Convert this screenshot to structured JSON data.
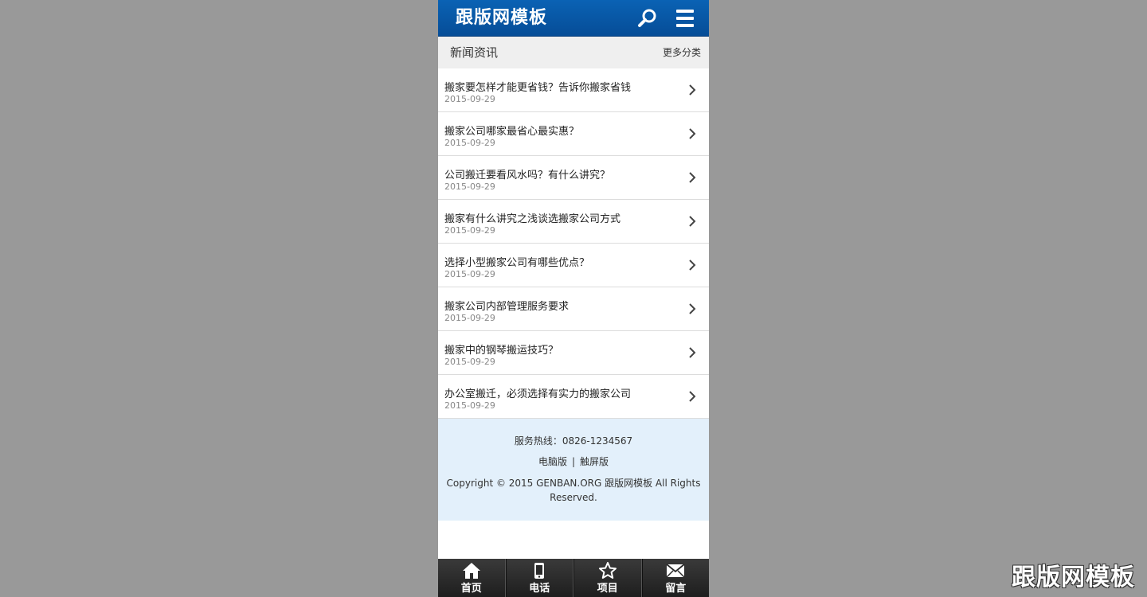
{
  "header": {
    "logo_text": "跟版网模板"
  },
  "section": {
    "title": "新闻资讯",
    "more_label": "更多分类"
  },
  "news": [
    {
      "title": "搬家要怎样才能更省钱？告诉你搬家省钱",
      "date": "2015-09-29"
    },
    {
      "title": "搬家公司哪家最省心最实惠？",
      "date": "2015-09-29"
    },
    {
      "title": "公司搬迁要看风水吗？有什么讲究？",
      "date": "2015-09-29"
    },
    {
      "title": "搬家有什么讲究之浅谈选搬家公司方式",
      "date": "2015-09-29"
    },
    {
      "title": "选择小型搬家公司有哪些优点？",
      "date": "2015-09-29"
    },
    {
      "title": "搬家公司内部管理服务要求",
      "date": "2015-09-29"
    },
    {
      "title": "搬家中的钢琴搬运技巧？",
      "date": "2015-09-29"
    },
    {
      "title": "办公室搬迁，必须选择有实力的搬家公司",
      "date": "2015-09-29"
    }
  ],
  "footer": {
    "hotline": "服务热线：0826-1234567",
    "desktop_label": "电脑版",
    "separator": "|",
    "touch_label": "触屏版",
    "copyright": "Copyright © 2015 GENBAN.ORG 跟版网模板 All Rights Reserved."
  },
  "bottom_nav": [
    {
      "label": "首页",
      "icon": "home-icon"
    },
    {
      "label": "电话",
      "icon": "phone-icon"
    },
    {
      "label": "项目",
      "icon": "star-icon"
    },
    {
      "label": "留言",
      "icon": "envelope-icon"
    }
  ],
  "watermark": "跟版网模板",
  "colors": {
    "header_blue": "#0a62b4",
    "page_bg": "#999999",
    "footer_bg": "#e3f0fb",
    "nav_bg": "#2a2a2a"
  }
}
